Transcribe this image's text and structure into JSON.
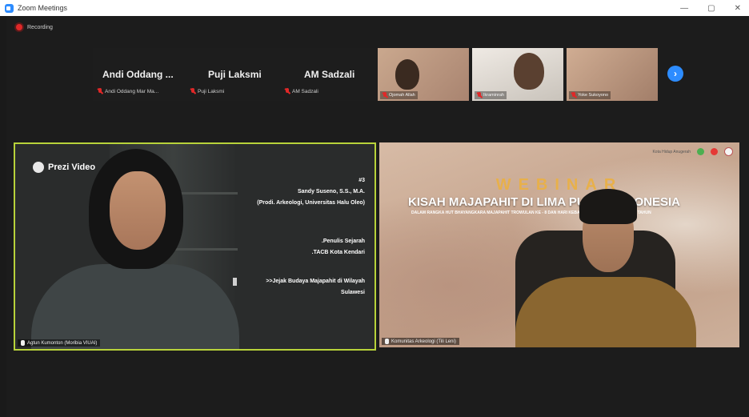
{
  "window": {
    "title": "Zoom Meetings",
    "controls": {
      "minimize": "—",
      "maximize": "▢",
      "close": "✕"
    }
  },
  "recording": {
    "label": "Recording"
  },
  "strip": {
    "participants": [
      {
        "display_name": "Andi Oddang ...",
        "label": "Andi Oddang Mar Ma..."
      },
      {
        "display_name": "Puji Laksmi",
        "label": "Puji Laksmi"
      },
      {
        "display_name": "AM Sadzali",
        "label": "AM Sadzali"
      }
    ],
    "video_tiles": [
      {
        "label": "Ojomah Allah"
      },
      {
        "label": "Ikraminrah"
      },
      {
        "label": "Yoke Sukoyono"
      }
    ],
    "next_icon": "chevron-right-icon"
  },
  "speaker_video": {
    "brand": "Prezi Video",
    "overlay_lines": [
      "#3",
      "Sandy Suseno, S.S., M.A.",
      "(Prodi. Arkeologi, Universitas Halu Oleo)",
      ".Penulis Sejarah",
      ".TACB Kota Kendari",
      ">>Jejak Budaya Majapahit di Wilayah",
      "Sulawesi"
    ],
    "label": "Agtun Kumonton (Moribia VIUAI)",
    "active_color": "#b8d23a"
  },
  "host_video": {
    "logos_text": "Kota Hidup Anugerah",
    "webinar_title": "WEBINAR",
    "headline": "KISAH MAJAPAHIT DI LIMA PULAU INDONESIA",
    "subline": "DALAM RANGKA HUT BHAYANGKARA MAJAPAHIT TROWULAN KE - 8 DAN HARI KEBANGKITAN NASIONAL KE - 113 TAHUN",
    "label": "Komunitas Arkeologi (Tili Leni)"
  }
}
